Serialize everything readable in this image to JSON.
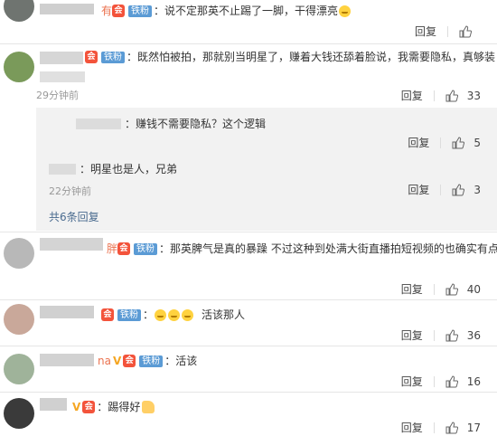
{
  "comments": [
    {
      "text": "说不定那英不止踢了一脚，干得漂亮",
      "name_suffix": "有",
      "badge": "铁粉",
      "reply": "回复",
      "likes": ""
    },
    {
      "text": "既然怕被拍，那就别当明星了，赚着大钱还舔着脸说，我需要隐私，真够装",
      "badge": "铁粉",
      "time": "29分钟前",
      "reply": "回复",
      "likes": "33"
    },
    {
      "text": "那英脾气是真的暴躁 不过这种到处满大街直播拍短视频的也确实有点",
      "name_suffix": "胖",
      "badge": "铁粉",
      "reply": "回复",
      "likes": "40"
    },
    {
      "text": "活该那人",
      "badge": "铁粉",
      "reply": "回复",
      "likes": "36"
    },
    {
      "text": "：活该",
      "name_suffix": "na",
      "badge": "铁粉",
      "reply": "回复",
      "likes": "16"
    },
    {
      "text": "踢得好",
      "badge": "",
      "reply": "回复",
      "likes": "17"
    }
  ],
  "replies": [
    {
      "text": "赚钱不需要隐私？这个逻辑",
      "reply": "回复",
      "likes": "5"
    },
    {
      "text": "明星也是人，兄弟",
      "time": "22分钟前",
      "reply": "回复",
      "likes": "3"
    }
  ],
  "more_replies": "共6条回复",
  "vip_glyph": "V",
  "colors": {
    "name": "#eb7350",
    "fan_badge": "#5b9bd5",
    "link": "#4a6b8f"
  }
}
